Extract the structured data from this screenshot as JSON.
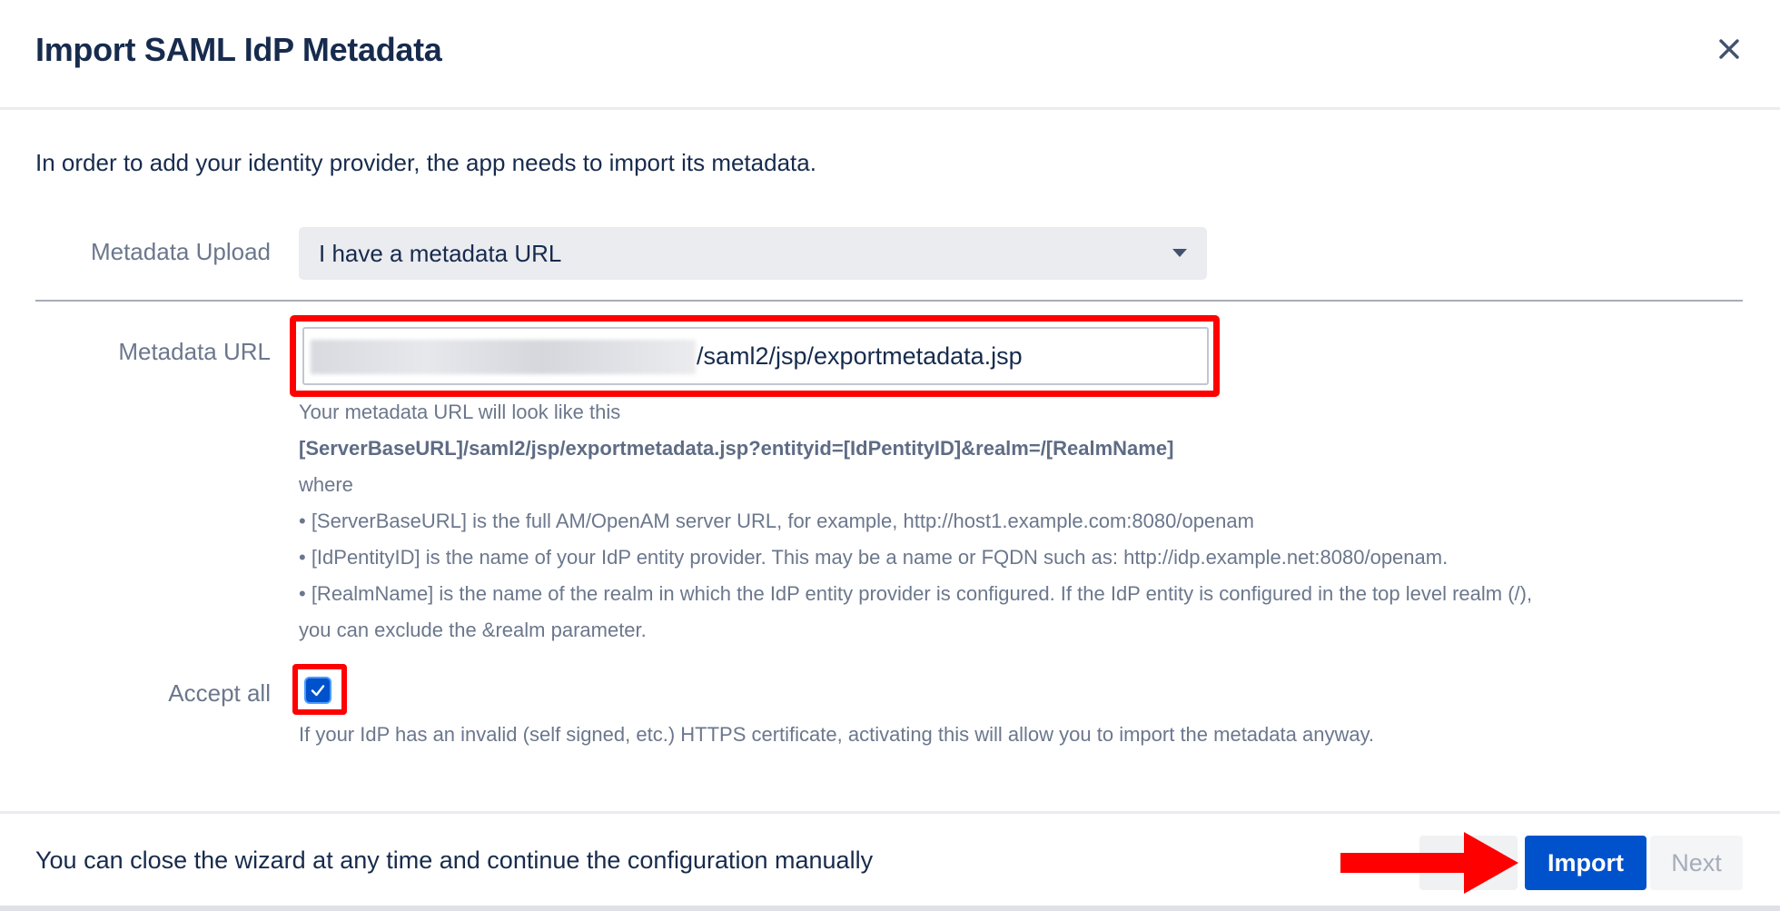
{
  "dialog": {
    "title": "Import SAML IdP Metadata",
    "close_icon": "close-icon"
  },
  "intro": "In order to add your identity provider, the app needs to import its metadata.",
  "upload": {
    "label": "Metadata Upload",
    "selected": "I have a metadata URL"
  },
  "url": {
    "label": "Metadata URL",
    "value_visible": "/saml2/jsp/exportmetadata.jsp",
    "help": [
      "Your metadata URL will look like this",
      "[ServerBaseURL]/saml2/jsp/exportmetadata.jsp?entityid=[IdPentityID]&realm=/[RealmName]",
      "where",
      "• [ServerBaseURL] is the full AM/OpenAM server URL, for example, http://host1.example.com:8080/openam",
      "• [IdPentityID] is the name of your IdP entity provider. This may be a name or FQDN such as: http://idp.example.net:8080/openam.",
      "• [RealmName] is the name of the realm in which the IdP entity provider is configured. If the IdP entity is configured in the top level realm (/),",
      "you can exclude the &realm parameter."
    ]
  },
  "accept": {
    "label": "Accept all",
    "checked": true,
    "help": "If your IdP has an invalid (self signed, etc.) HTTPS certificate, activating this will allow you to import the metadata anyway."
  },
  "footer": {
    "text": "You can close the wizard at any time and continue the configuration manually",
    "import_label": "Import",
    "next_label": "Next"
  },
  "colors": {
    "primary": "#0052cc",
    "highlight": "#ff0000",
    "text": "#172b4d",
    "subtle": "#6b778c"
  }
}
